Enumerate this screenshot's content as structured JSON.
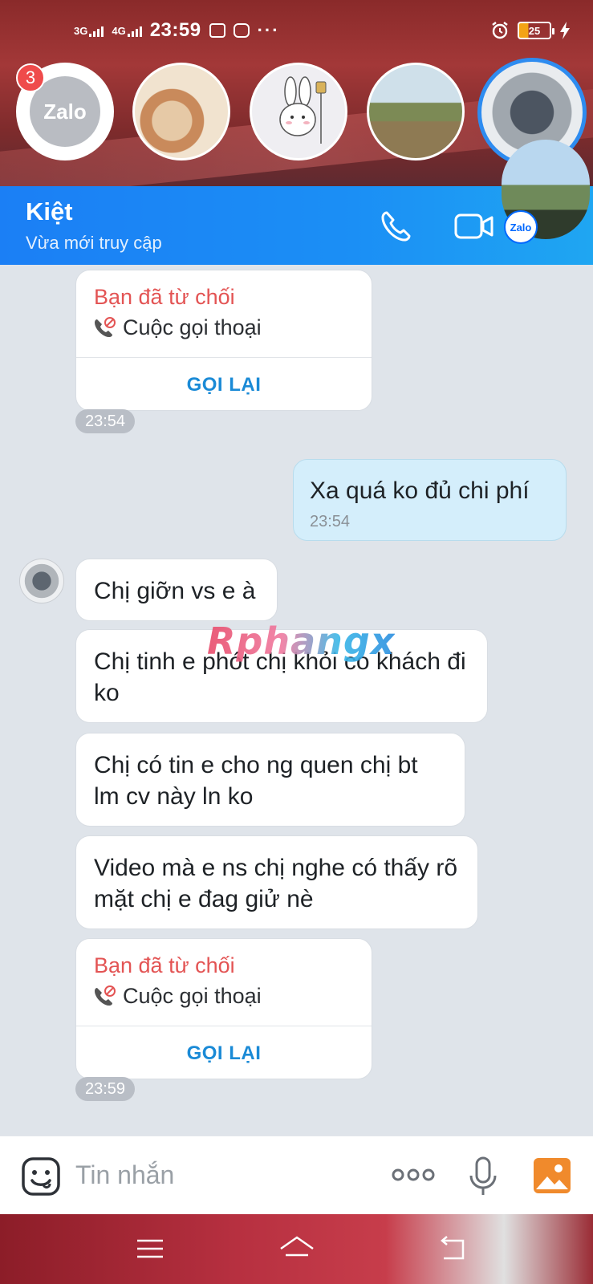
{
  "status_bar": {
    "network_1": "3G",
    "network_2": "4G",
    "time": "23:59",
    "battery": "25"
  },
  "chat_heads": {
    "unread_badge": "3",
    "zalo_logo_text": "Zalo"
  },
  "header": {
    "contact_name": "Kiệt",
    "contact_status": "Vừa mới truy cập"
  },
  "messages": {
    "missed_call_1": {
      "title": "Bạn đã từ chối",
      "subtitle": "Cuộc gọi thoại",
      "action": "GỌI LẠI",
      "time": "23:54"
    },
    "outgoing_1": {
      "text": "Xa quá ko đủ chi phí",
      "time": "23:54"
    },
    "incoming": [
      "Chị giỡn vs e à",
      "Chị tinh e phót chị khỏi co khách đi ko",
      "Chị có tin e cho ng quen chị bt lm cv này ln ko",
      "Video mà e ns chị nghe có thấy rõ mặt chị e đag giử nè"
    ],
    "missed_call_2": {
      "title": "Bạn đã từ chối",
      "subtitle": "Cuộc gọi thoại",
      "action": "GỌI LẠI",
      "time": "23:59"
    }
  },
  "watermark": "Rphangx",
  "input_bar": {
    "placeholder": "Tin nhắn"
  },
  "colors": {
    "header_blue": "#1b7ff5",
    "missed_call_red": "#e35454",
    "call_back_blue": "#1a8ad6",
    "outgoing_bubble": "#d4eefb"
  }
}
